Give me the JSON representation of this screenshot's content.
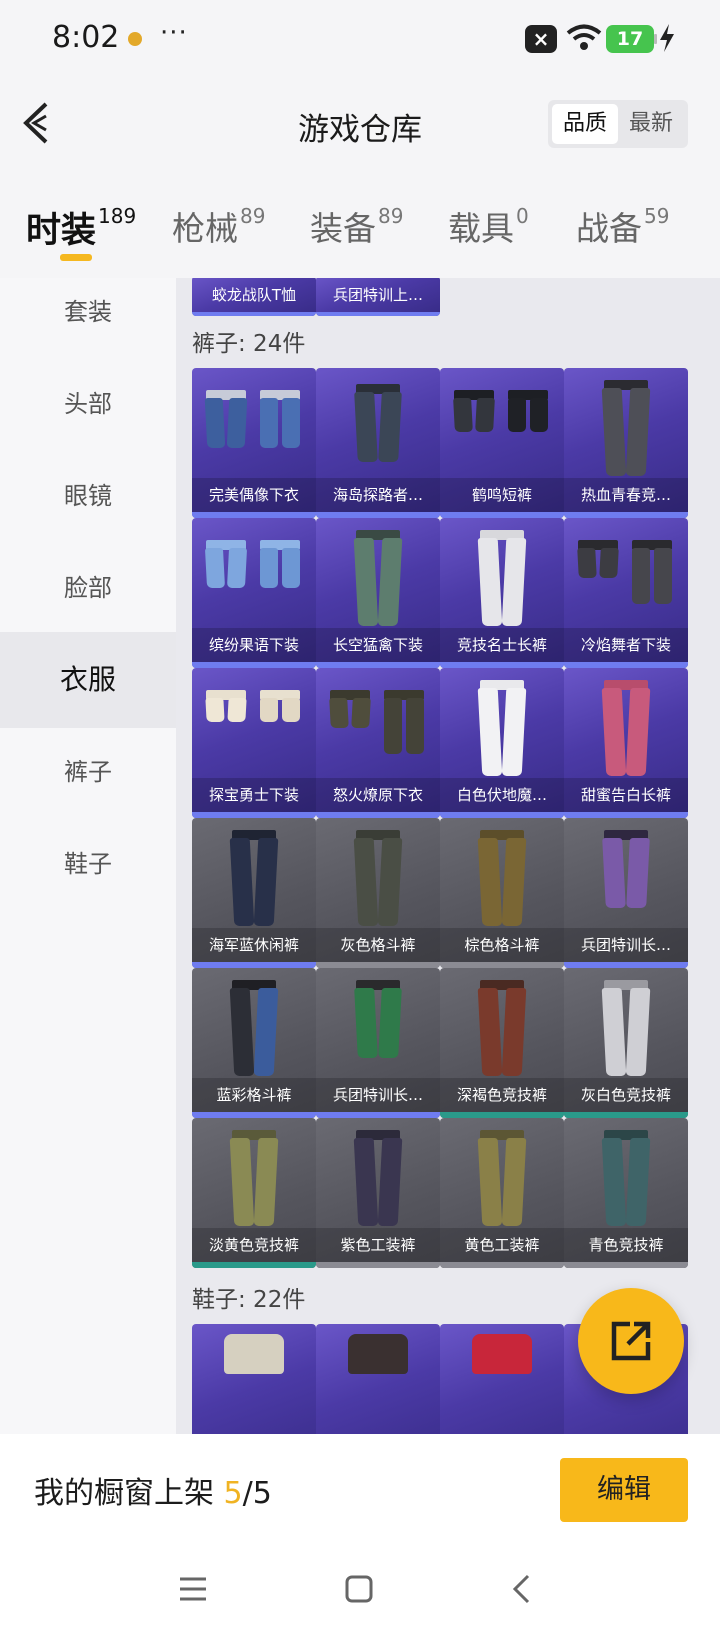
{
  "status": {
    "time": "8:02",
    "dots": "···",
    "battery": "17"
  },
  "header": {
    "back_label": "back",
    "title": "游戏仓库",
    "sort": [
      "品质",
      "最新"
    ]
  },
  "tabs": [
    {
      "label": "时装",
      "count": "189"
    },
    {
      "label": "枪械",
      "count": "89"
    },
    {
      "label": "装备",
      "count": "89"
    },
    {
      "label": "载具",
      "count": "0"
    },
    {
      "label": "战备",
      "count": "59"
    }
  ],
  "sidebar": [
    "套装",
    "头部",
    "眼镜",
    "脸部",
    "衣服",
    "裤子",
    "鞋子"
  ],
  "top_items": [
    "蛟龙战队T恤",
    "兵团特训上…"
  ],
  "pants_section": {
    "label": "裤子: 24件"
  },
  "pants_items": [
    "完美偶像下衣",
    "海岛探路者…",
    "鹤鸣短裤",
    "热血青春竞…",
    "缤纷果语下装",
    "长空猛禽下装",
    "竞技名士长裤",
    "冷焰舞者下装",
    "探宝勇士下装",
    "怒火燎原下衣",
    "白色伏地魔…",
    "甜蜜告白长裤",
    "海军蓝休闲裤",
    "灰色格斗裤",
    "棕色格斗裤",
    "兵团特训长…",
    "蓝彩格斗裤",
    "兵团特训长…",
    "深褐色竞技裤",
    "灰白色竞技裤",
    "淡黄色竞技裤",
    "紫色工装裤",
    "黄色工装裤",
    "青色竞技裤"
  ],
  "shoes_section": {
    "label": "鞋子: 22件"
  },
  "bottom": {
    "text": "我的橱窗上架 ",
    "count_a": "5",
    "count_b": "/5",
    "edit": "编辑"
  },
  "colors": {
    "accent": "#f8b81a",
    "purple_card": "#4b3aa6",
    "gray_card": "#55555d"
  }
}
